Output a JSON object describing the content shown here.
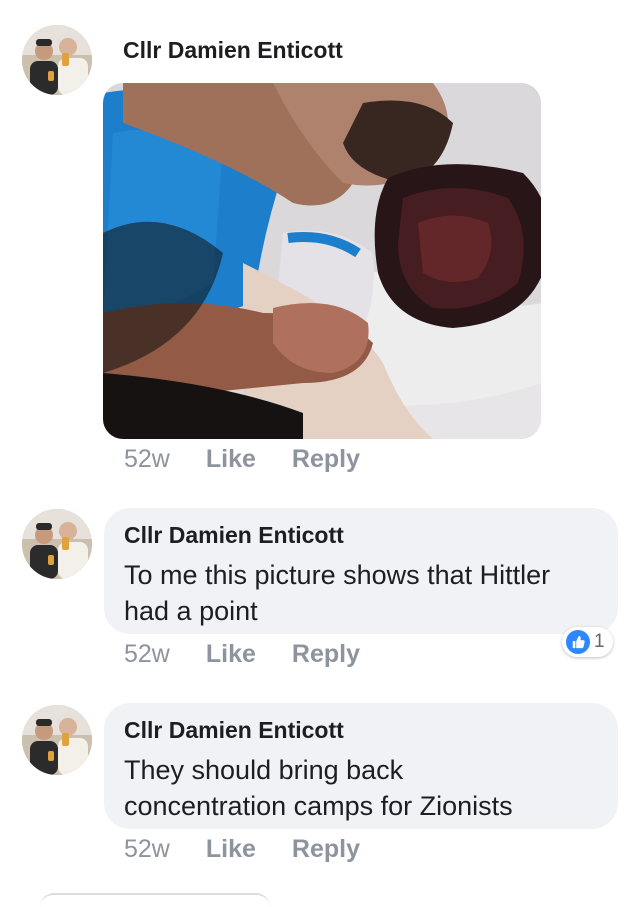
{
  "theme": {
    "bubble_bg": "#f0f2f5",
    "text_color": "#1c1e21",
    "meta_color": "#8d949e",
    "reaction_blue": "#2d88ff"
  },
  "comments": [
    {
      "author": "Cllr Damien Enticott",
      "has_photo": true,
      "photo_icon": "photo-image",
      "time": "52w",
      "like_label": "Like",
      "reply_label": "Reply"
    },
    {
      "author": "Cllr Damien Enticott",
      "text": "To me this picture shows that Hittler had a point",
      "time": "52w",
      "like_label": "Like",
      "reply_label": "Reply",
      "reactions": {
        "icon": "like-icon",
        "count": "1"
      }
    },
    {
      "author": "Cllr Damien Enticott",
      "text": "They should bring back concentration camps for Zionists",
      "time": "52w",
      "like_label": "Like",
      "reply_label": "Reply"
    }
  ]
}
